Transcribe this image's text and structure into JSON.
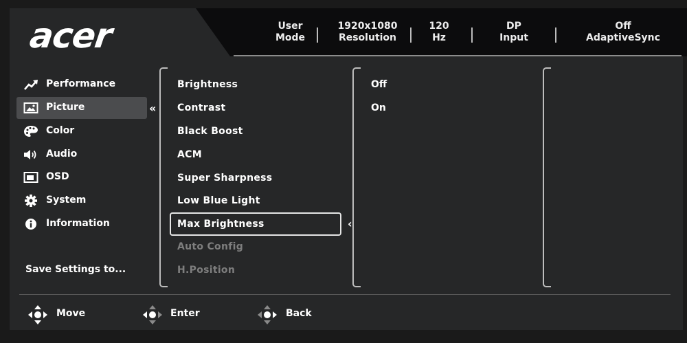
{
  "brand": {
    "logo_text": "acer"
  },
  "status_bar": [
    {
      "value": "User",
      "label": "Mode"
    },
    {
      "value": "1920x1080",
      "label": "Resolution"
    },
    {
      "value": "120",
      "label": "Hz"
    },
    {
      "value": "DP",
      "label": "Input"
    },
    {
      "value": "Off",
      "label": "AdaptiveSync"
    }
  ],
  "sidebar": {
    "items": [
      {
        "label": "Performance",
        "icon": "trend-up-icon"
      },
      {
        "label": "Picture",
        "icon": "picture-icon",
        "selected": true
      },
      {
        "label": "Color",
        "icon": "palette-icon"
      },
      {
        "label": "Audio",
        "icon": "speaker-icon"
      },
      {
        "label": "OSD",
        "icon": "osd-window-icon"
      },
      {
        "label": "System",
        "icon": "gear-icon"
      },
      {
        "label": "Information",
        "icon": "info-icon"
      }
    ],
    "save_label": "Save Settings to..."
  },
  "picture_menu": {
    "items": [
      {
        "label": "Brightness"
      },
      {
        "label": "Contrast"
      },
      {
        "label": "Black Boost"
      },
      {
        "label": "ACM"
      },
      {
        "label": "Super Sharpness"
      },
      {
        "label": "Low Blue Light"
      },
      {
        "label": "Max Brightness",
        "highlighted": true
      },
      {
        "label": "Auto Config",
        "disabled": true
      },
      {
        "label": "H.Position",
        "disabled": true
      }
    ]
  },
  "options": [
    {
      "label": "Off"
    },
    {
      "label": "On"
    }
  ],
  "footer": {
    "hints": [
      {
        "label": "Move",
        "icon": "dpad-move-icon"
      },
      {
        "label": "Enter",
        "icon": "dpad-enter-icon"
      },
      {
        "label": "Back",
        "icon": "dpad-back-icon"
      }
    ]
  },
  "colors": {
    "panel": "#262728",
    "selection": "#4b4c4e",
    "text": "#ffffff",
    "disabled_text": "#7e7e7e"
  }
}
